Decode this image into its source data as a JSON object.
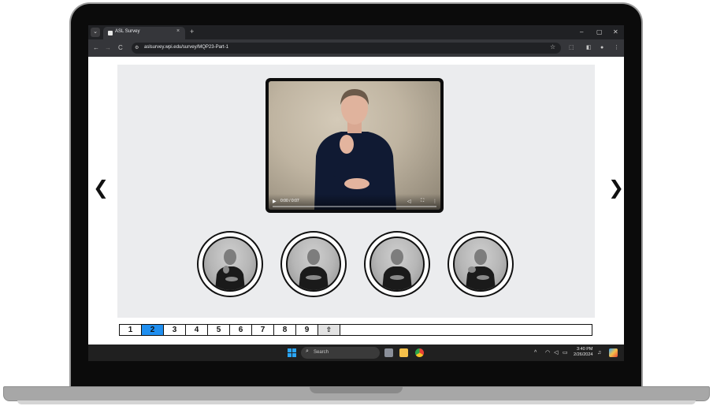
{
  "browser": {
    "tab_title": "ASL Survey",
    "tab_close": "×",
    "new_tab": "+",
    "url": "aslsurvey.wpi.edu/survey/MQP23-Part-1",
    "window_controls": [
      "–",
      "▢",
      "✕"
    ],
    "nav": [
      "←",
      "→",
      "C"
    ]
  },
  "page": {
    "prev_arrow": "❮",
    "next_arrow": "❯",
    "video": {
      "time": "0:00 / 0:07",
      "progress": 0.0
    },
    "choices_count": 4,
    "pager": {
      "pages": [
        "1",
        "2",
        "3",
        "4",
        "5",
        "6",
        "7",
        "8",
        "9"
      ],
      "active": "2",
      "upload_icon": "upload-icon"
    }
  },
  "taskbar": {
    "search_label": "Search",
    "time": "3:40 PM",
    "date": "2/26/2024"
  }
}
